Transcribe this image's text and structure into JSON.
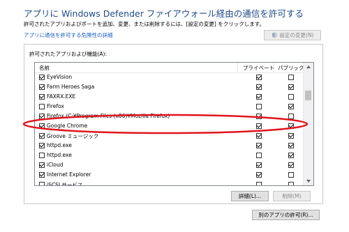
{
  "title": "アプリに Windows Defender ファイアウォール経由の通信を許可する",
  "description": "許可されたアプリおよびポートを追加、変更、または削除するには、[設定の変更] をクリックします。",
  "risk_link": "アプリに通信を許可する危険性の詳細",
  "change_settings_label": "設定の変更(N)",
  "group_label": "許可されたアプリおよび機能(A):",
  "columns": {
    "name": "名前",
    "private": "プライベート",
    "public": "パブリック"
  },
  "apps": [
    {
      "name": "EyeVision",
      "enabled": true,
      "private": true,
      "public": false
    },
    {
      "name": "Farm Heroes Saga",
      "enabled": true,
      "private": true,
      "public": true
    },
    {
      "name": "FAXRX.EXE",
      "enabled": true,
      "private": true,
      "public": false
    },
    {
      "name": "Firefox",
      "enabled": false,
      "private": false,
      "public": true
    },
    {
      "name": "Firefox (C:¥Program Files (x86)¥Mozilla Firefox)",
      "enabled": true,
      "private": true,
      "public": false
    },
    {
      "name": "Google Chrome",
      "enabled": true,
      "private": true,
      "public": true
    },
    {
      "name": "Groove ミュージック",
      "enabled": true,
      "private": true,
      "public": true
    },
    {
      "name": "httpd.exe",
      "enabled": true,
      "private": true,
      "public": true
    },
    {
      "name": "httpd.exe",
      "enabled": false,
      "private": false,
      "public": true
    },
    {
      "name": "iCloud",
      "enabled": true,
      "private": true,
      "public": true
    },
    {
      "name": "Internet Explorer",
      "enabled": true,
      "private": true,
      "public": false
    },
    {
      "name": "iSCSI サービス",
      "enabled": false,
      "private": false,
      "public": false
    }
  ],
  "details_label": "詳細(L)...",
  "delete_label": "削除(M)",
  "allow_other_label": "別のアプリの許可(R)...",
  "highlight_color": "#e0141e"
}
